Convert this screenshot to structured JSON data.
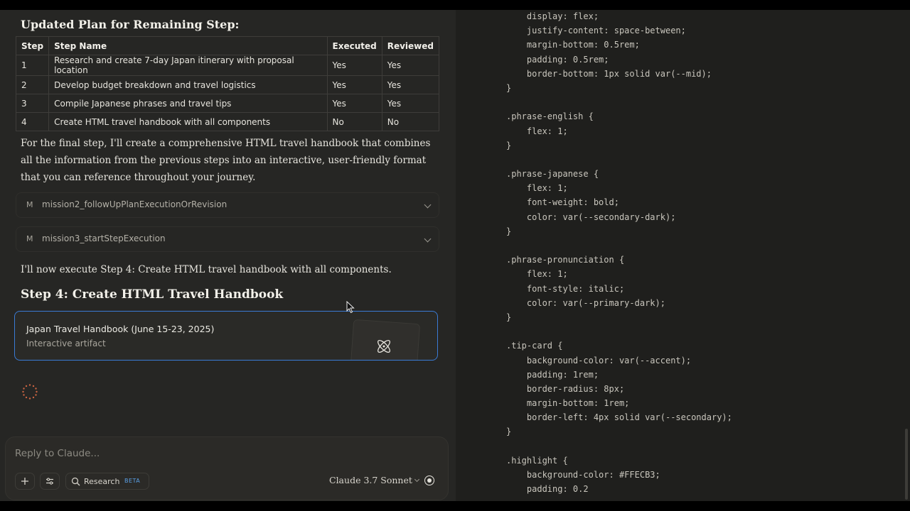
{
  "chat": {
    "plan_heading": "Updated Plan for Remaining Step:",
    "table": {
      "headers": [
        "Step",
        "Step Name",
        "Executed",
        "Reviewed"
      ],
      "rows": [
        [
          "1",
          "Research and create 7-day Japan itinerary with proposal location",
          "Yes",
          "Yes"
        ],
        [
          "2",
          "Develop budget breakdown and travel logistics",
          "Yes",
          "Yes"
        ],
        [
          "3",
          "Compile Japanese phrases and travel tips",
          "Yes",
          "Yes"
        ],
        [
          "4",
          "Create HTML travel handbook with all components",
          "No",
          "No"
        ]
      ]
    },
    "intro_paragraph": "For the final step, I'll create a comprehensive HTML travel handbook that combines all the information from the previous steps into an interactive, user-friendly format that you can reference throughout your journey.",
    "tool_calls": [
      {
        "badge": "M",
        "name": "mission2_followUpPlanExecutionOrRevision",
        "icon": "chevron-down-icon"
      },
      {
        "badge": "M",
        "name": "mission3_startStepExecution",
        "icon": "chevron-down-icon"
      }
    ],
    "execute_paragraph": "I'll now execute Step 4: Create HTML travel handbook with all components.",
    "step_heading": "Step 4: Create HTML Travel Handbook",
    "artifact": {
      "title": "Japan Travel Handbook (June 15-23, 2025)",
      "subtitle": "Interactive artifact",
      "icon": "atom-icon"
    }
  },
  "composer": {
    "placeholder": "Reply to Claude...",
    "research_label": "Research",
    "beta_badge": "BETA",
    "model_label": "Claude 3.7 Sonnet"
  },
  "code": {
    "lines": [
      "    display: flex;",
      "    justify-content: space-between;",
      "    margin-bottom: 0.5rem;",
      "    padding: 0.5rem;",
      "    border-bottom: 1px solid var(--mid);",
      "}",
      "",
      ".phrase-english {",
      "    flex: 1;",
      "}",
      "",
      ".phrase-japanese {",
      "    flex: 1;",
      "    font-weight: bold;",
      "    color: var(--secondary-dark);",
      "}",
      "",
      ".phrase-pronunciation {",
      "    flex: 1;",
      "    font-style: italic;",
      "    color: var(--primary-dark);",
      "}",
      "",
      ".tip-card {",
      "    background-color: var(--accent);",
      "    padding: 1rem;",
      "    border-radius: 8px;",
      "    margin-bottom: 1rem;",
      "    border-left: 4px solid var(--secondary);",
      "}",
      "",
      ".highlight {",
      "    background-color: #FFECB3;",
      "    padding: 0.2"
    ]
  },
  "colors": {
    "chat_bg": "#262624",
    "code_bg": "#1f1f1d",
    "artifact_border": "#3a7bd5",
    "beta_color": "#5aa0e6"
  }
}
